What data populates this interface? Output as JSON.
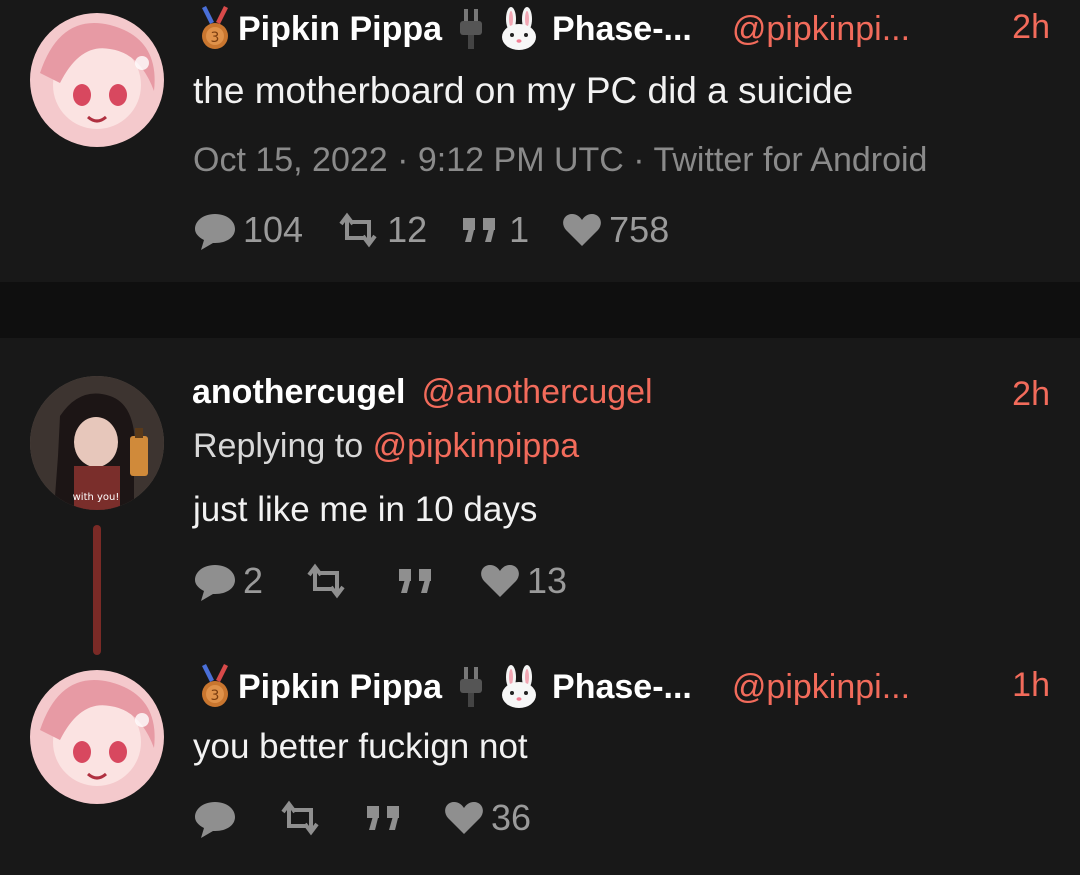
{
  "tweets": [
    {
      "author": "Pipkin Pippa",
      "author_suffix": "Phase-...",
      "handle": "@pipkinpi...",
      "time": "2h",
      "text": "the motherboard on my PC did a suicide",
      "meta": "Oct 15, 2022 · 9:12 PM UTC · Twitter for Android",
      "stats": {
        "replies": "104",
        "retweets": "12",
        "quotes": "1",
        "likes": "758"
      }
    },
    {
      "author": "anothercugel",
      "handle": "@anothercugel",
      "time": "2h",
      "replying_label": "Replying to",
      "replying_handle": "@pipkinpippa",
      "text": "just like me in 10 days",
      "avatar_caption": "with you!",
      "stats": {
        "replies": "2",
        "retweets": "",
        "quotes": "",
        "likes": "13"
      }
    },
    {
      "author": "Pipkin Pippa",
      "author_suffix": "Phase-...",
      "handle": "@pipkinpi...",
      "time": "1h",
      "text": "you better fuckign not",
      "stats": {
        "replies": "",
        "retweets": "",
        "quotes": "",
        "likes": "36"
      }
    }
  ],
  "colors": {
    "accent": "#f26b5b",
    "background": "#181818",
    "muted": "#8a8a8a",
    "thread_line": "#7a2a26"
  }
}
